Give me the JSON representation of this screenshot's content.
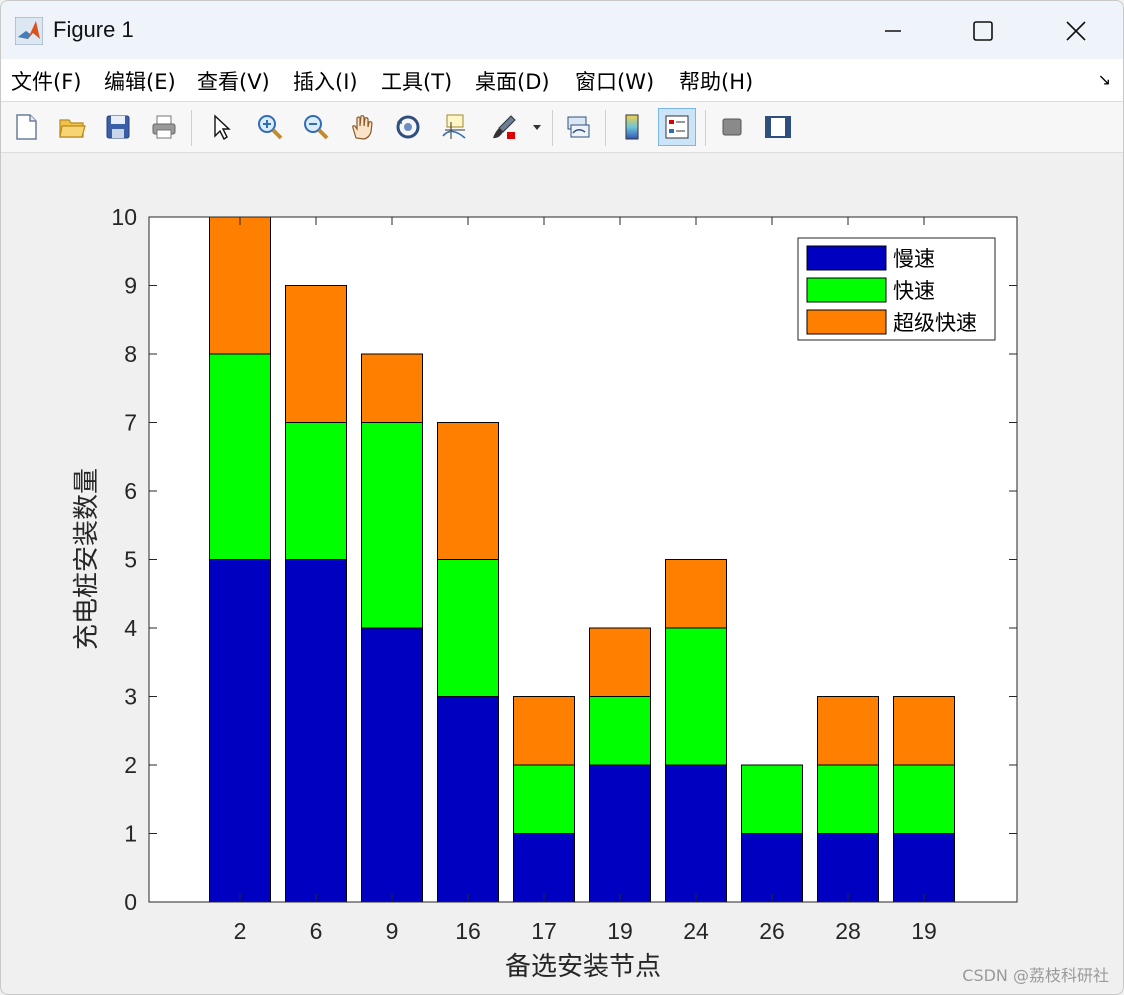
{
  "window": {
    "title": "Figure 1"
  },
  "menu": {
    "items": [
      {
        "label": "文件(F)",
        "key": "F"
      },
      {
        "label": "编辑(E)",
        "key": "E"
      },
      {
        "label": "查看(V)",
        "key": "V"
      },
      {
        "label": "插入(I)",
        "key": "I"
      },
      {
        "label": "工具(T)",
        "key": "T"
      },
      {
        "label": "桌面(D)",
        "key": "D"
      },
      {
        "label": "窗口(W)",
        "key": "W"
      },
      {
        "label": "帮助(H)",
        "key": "H"
      }
    ]
  },
  "toolbar": {
    "icons": [
      "new-file-icon",
      "open-folder-icon",
      "save-icon",
      "print-icon",
      "pointer-icon",
      "zoom-in-icon",
      "zoom-out-icon",
      "pan-hand-icon",
      "rotate-3d-icon",
      "data-cursor-icon",
      "brush-icon",
      "link-plot-icon",
      "colorbar-icon",
      "legend-icon",
      "hide-plot-tools-icon",
      "show-plot-tools-icon"
    ]
  },
  "colors": {
    "slow": "#0000c0",
    "fast": "#00ff00",
    "superfast": "#ff8000"
  },
  "watermark": "CSDN @荔枝科研社",
  "chart_data": {
    "type": "bar",
    "stacked": true,
    "categories": [
      "2",
      "6",
      "9",
      "16",
      "17",
      "19",
      "24",
      "26",
      "28",
      "19"
    ],
    "series": [
      {
        "name": "慢速",
        "values": [
          5,
          5,
          4,
          3,
          1,
          2,
          2,
          1,
          1,
          1
        ],
        "color": "#0000c0"
      },
      {
        "name": "快速",
        "values": [
          3,
          2,
          3,
          2,
          1,
          1,
          2,
          1,
          1,
          1
        ],
        "color": "#00ff00"
      },
      {
        "name": "超级快速",
        "values": [
          2,
          2,
          1,
          2,
          1,
          1,
          1,
          0,
          1,
          1
        ],
        "color": "#ff8000"
      }
    ],
    "xlabel": "备选安装节点",
    "ylabel": "充电桩安装数量",
    "ylim": [
      0,
      10
    ],
    "yticks": [
      0,
      1,
      2,
      3,
      4,
      5,
      6,
      7,
      8,
      9,
      10
    ],
    "grid": false,
    "legend": "top-right"
  }
}
